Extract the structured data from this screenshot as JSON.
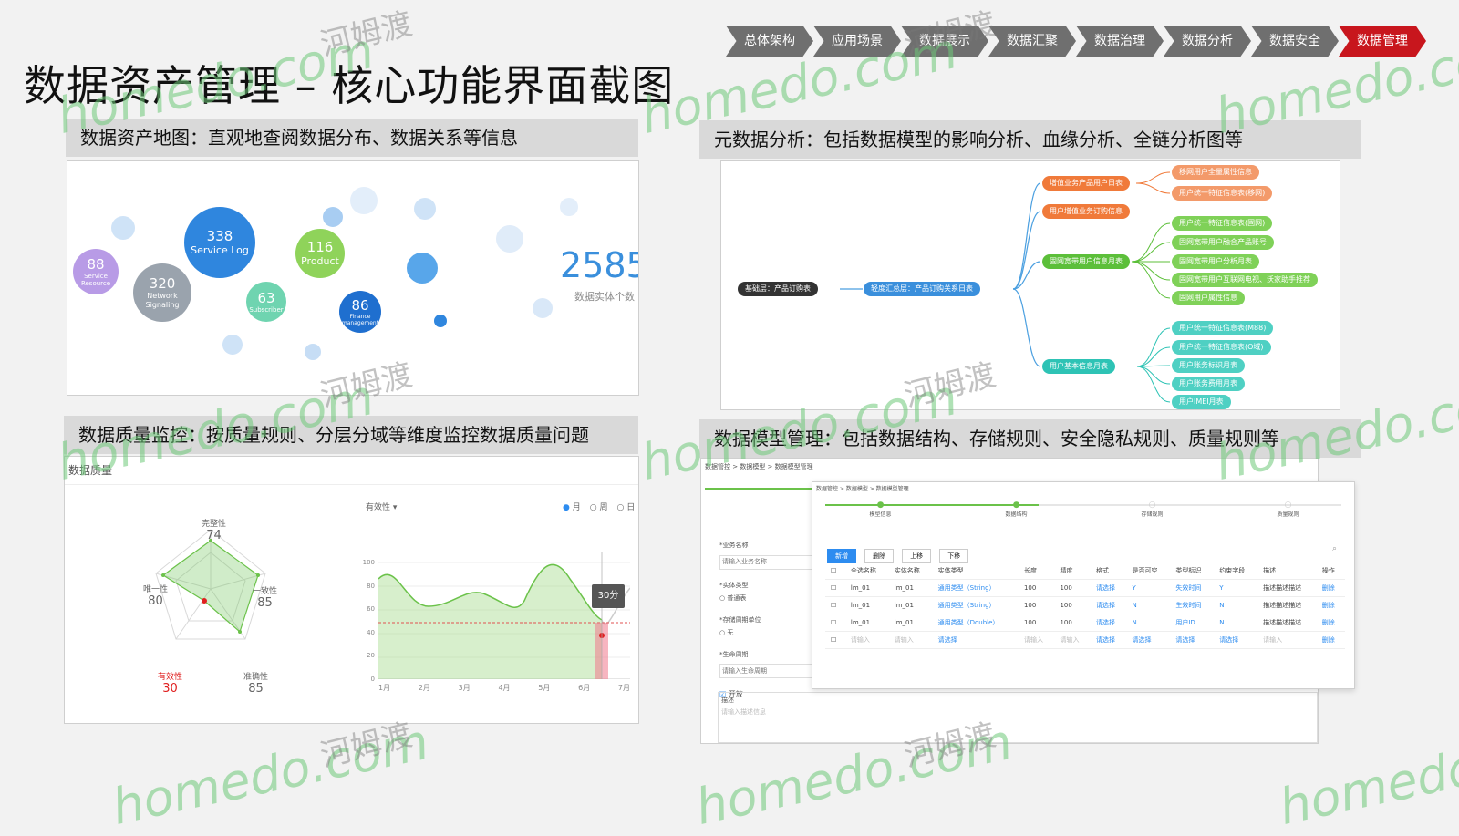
{
  "title": "数据资产管理 – 核心功能界面截图",
  "nav": [
    "总体架构",
    "应用场景",
    "数据展示",
    "数据汇聚",
    "数据治理",
    "数据分析",
    "数据安全",
    "数据管理"
  ],
  "panels": {
    "map": {
      "heading": "数据资产地图：直观地查阅数据分布、数据关系等信息"
    },
    "meta": {
      "heading": "元数据分析：包括数据模型的影响分析、血缘分析、全链分析图等"
    },
    "quality": {
      "heading": "数据质量监控：按质量规则、分层分域等维度监控数据质量问题"
    },
    "model": {
      "heading": "数据模型管理：包括数据结构、存储规则、安全隐私规则、质量规则等"
    }
  },
  "asset_map": {
    "bubbles": [
      {
        "num": "88",
        "label": "Service Resource",
        "color": "#b89be6"
      },
      {
        "num": "320",
        "label": "Network Signaling",
        "color": "#9aa3ad"
      },
      {
        "num": "338",
        "label": "Service Log",
        "color": "#2f86de"
      },
      {
        "num": "63",
        "label": "Subscriber",
        "color": "#6fd4b0"
      },
      {
        "num": "116",
        "label": "Product",
        "color": "#8fd35a"
      },
      {
        "num": "86",
        "label": "Finance management",
        "color": "#1f6fcf"
      }
    ],
    "total": "2585+",
    "total_label": "数据实体个数"
  },
  "lineage": {
    "root": "基础层：产品订购表",
    "mid": "轻度汇总层：产品订购关系日表",
    "branches": [
      {
        "name": "增值业务产品用户日表",
        "color": "#f07a3a",
        "children": [
          "移网用户全量属性信息",
          "用户统一特征信息表(移网)"
        ]
      },
      {
        "name": "用户增值业务订购信息",
        "color": "#f07a3a",
        "children": []
      },
      {
        "name": "固网宽带用户信息月表",
        "color": "#5cbf3a",
        "children": [
          "用户统一特征信息表(固网)",
          "固网宽带用户融合产品账号",
          "固网宽带用户分析月表",
          "固网宽带用户互联网电视、沃家助手推荐",
          "固网用户属性信息"
        ]
      },
      {
        "name": "用户基本信息月表",
        "color": "#2ec3b5",
        "children": [
          "用户统一特征信息表(M88)",
          "用户统一特征信息表(O域)",
          "用户账务标识月表",
          "用户账务费用月表",
          "用户IMEI月表"
        ]
      }
    ]
  },
  "quality": {
    "app_label": "数据质量",
    "radar": {
      "axes": [
        {
          "name": "完整性",
          "value": "74"
        },
        {
          "name": "一致性",
          "value": "85"
        },
        {
          "name": "准确性",
          "value": "85"
        },
        {
          "name": "有效性",
          "value": "30"
        },
        {
          "name": "唯一性",
          "value": "80"
        }
      ]
    },
    "line": {
      "dropdown": "有效性",
      "legend": [
        "月",
        "周",
        "日"
      ],
      "y_ticks": [
        "100",
        "80",
        "60",
        "40",
        "20",
        "0"
      ],
      "x_ticks": [
        "1月",
        "2月",
        "3月",
        "4月",
        "5月",
        "6月",
        "7月"
      ],
      "tooltip": "30分"
    }
  },
  "model_ui": {
    "breadcrumb_back": "数据管控 > 数据模型 > 数据模型管理",
    "breadcrumb_front": "数据管控 > 数据模型 > 数据模型管理",
    "steps": [
      "模型信息",
      "数据结构",
      "存储规则",
      "质量规则"
    ],
    "form": [
      {
        "label": "*业务名称",
        "placeholder": "请输入业务名称"
      },
      {
        "label": "*实体类型",
        "value": "普通表"
      },
      {
        "label": "*存储周期单位",
        "value": "无"
      },
      {
        "label": "*生命周期",
        "placeholder": "请输入生命周期"
      }
    ],
    "checkbox_label": "开放",
    "desc_label": "描述",
    "desc_placeholder": "请输入描述信息",
    "buttons": [
      "新增",
      "删除",
      "上移",
      "下移"
    ],
    "columns": [
      "全选名称",
      "实体名称",
      "实体类型",
      "长度",
      "精度",
      "格式",
      "是否可空",
      "类型标识",
      "约束字段",
      "描述",
      "操作"
    ],
    "rows": [
      [
        "lm_01",
        "lm_01",
        "通用类型（String）",
        "100",
        "100",
        "请选择",
        "Y",
        "失效时间",
        "Y",
        "描述描述描述",
        "删除"
      ],
      [
        "lm_01",
        "lm_01",
        "通用类型（String）",
        "100",
        "100",
        "请选择",
        "N",
        "生效时间",
        "N",
        "描述描述描述",
        "删除"
      ],
      [
        "lm_01",
        "lm_01",
        "通用类型（Double）",
        "100",
        "100",
        "请选择",
        "N",
        "用户ID",
        "N",
        "描述描述描述",
        "删除"
      ],
      [
        "请输入",
        "请输入",
        "请选择",
        "请输入",
        "请输入",
        "请选择",
        "请选择",
        "请选择",
        "请选择",
        "请输入",
        "删除"
      ]
    ]
  },
  "watermark": {
    "text": "homedo.com",
    "cn": "河姆渡"
  }
}
